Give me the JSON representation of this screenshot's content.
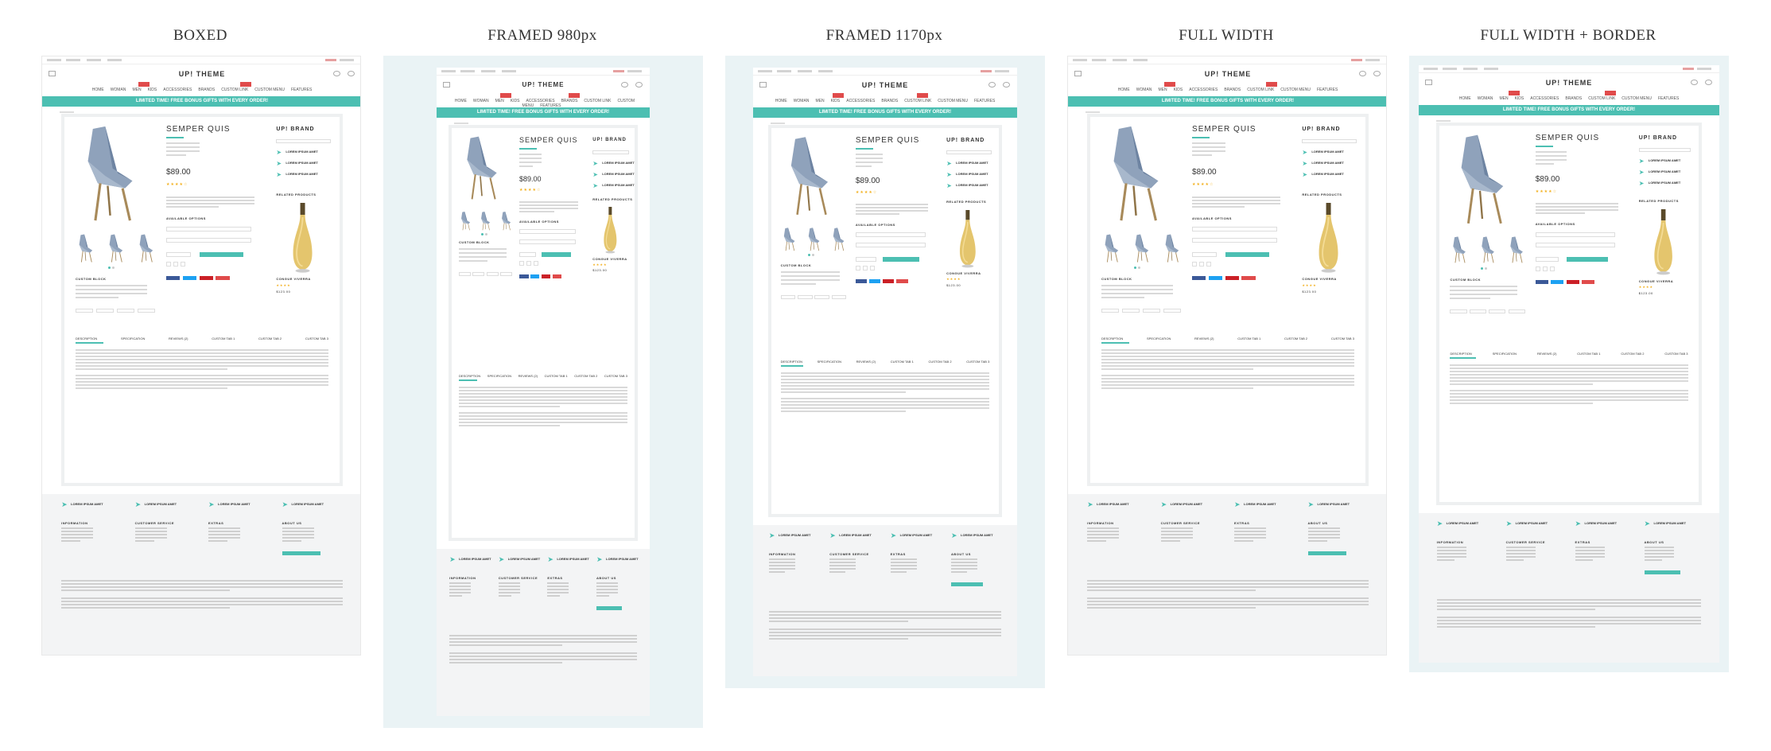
{
  "layouts": [
    {
      "title": "BOXED"
    },
    {
      "title": "FRAMED 980px"
    },
    {
      "title": "FRAMED 1170px"
    },
    {
      "title": "FULL WIDTH"
    },
    {
      "title": "FULL WIDTH + BORDER"
    }
  ],
  "store": {
    "logo": "UP! THEME",
    "banner": "LIMITED TIME! FREE BONUS GIFTS WITH EVERY ORDER!",
    "nav": [
      "HOME",
      "WOMAN",
      "MEN",
      "KIDS",
      "ACCESSORIES",
      "BRANDS",
      "CUSTOM LINK",
      "CUSTOM MENU",
      "FEATURES"
    ],
    "hot_badge": "HOT"
  },
  "product": {
    "title": "SEMPER QUIS",
    "price": "$89.00",
    "brand": "UP! BRAND",
    "related": "RELATED PRODUCTS",
    "options": "AVAILABLE OPTIONS",
    "custom_block": "CUSTOM BLOCK",
    "feature": "LOREM IPSUM AMET",
    "related_item": "CONGUE VIVERRA",
    "related_price": "$123.00",
    "add_to_cart": "ADD TO CART",
    "select": "--- PLEASE SELECT ---",
    "tabs": [
      "DESCRIPTION",
      "SPECIFICATION",
      "REVIEWS (2)",
      "CUSTOM TAB 1",
      "CUSTOM TAB 2",
      "CUSTOM TAB 3"
    ]
  },
  "footer": {
    "columns": [
      "INFORMATION",
      "CUSTOMER SERVICE",
      "EXTRAS",
      "ABOUT US"
    ],
    "feature": "LOREM IPSUM AMET"
  },
  "colors": {
    "accent": "#4cbfb2",
    "hot": "#e04b4b",
    "frame": "#eaf3f5"
  }
}
